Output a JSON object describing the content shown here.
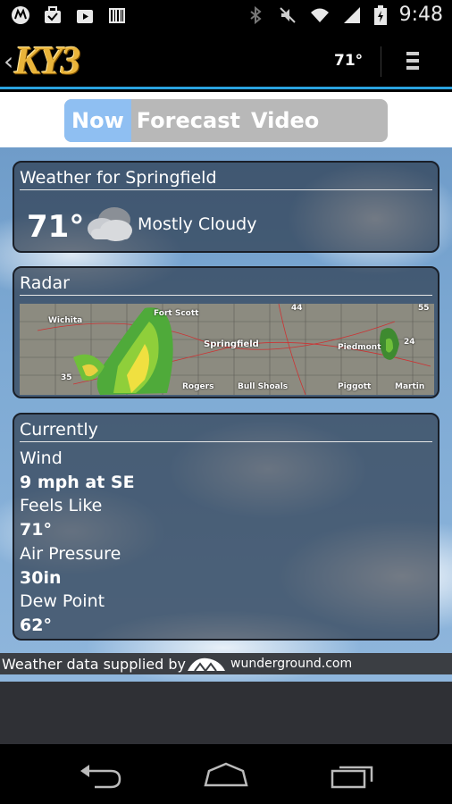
{
  "status_bar": {
    "time": "9:48",
    "left_icons": [
      "motorola-icon",
      "briefcase-icon",
      "play-store-icon",
      "barcode-icon"
    ],
    "right_icons": [
      "bluetooth-icon",
      "mute-icon",
      "wifi-icon",
      "signal-icon",
      "battery-icon"
    ]
  },
  "app_bar": {
    "logo_text": "KY3",
    "temperature": "71°",
    "menu_icon": "menu-icon"
  },
  "tabs": [
    {
      "label": "Now",
      "active": true
    },
    {
      "label": "Forecast",
      "active": false
    },
    {
      "label": "Video Forecast",
      "active": false
    }
  ],
  "weather_card": {
    "title": "Weather for Springfield",
    "temperature": "71°",
    "condition": "Mostly Cloudy",
    "icon": "cloud-icon"
  },
  "radar_card": {
    "title": "Radar",
    "map_labels": [
      "Wichita",
      "Fort Scott",
      "Springfield",
      "Piedmont",
      "Rogers",
      "Bull Shoals",
      "Piggott",
      "Martin",
      "35",
      "44",
      "24",
      "55"
    ]
  },
  "currently_card": {
    "title": "Currently",
    "rows": [
      {
        "label": "Wind",
        "value": "9 mph at SE"
      },
      {
        "label": "Feels Like",
        "value": "71°"
      },
      {
        "label": "Air Pressure",
        "value": "30in"
      },
      {
        "label": "Dew Point",
        "value": "62°"
      }
    ]
  },
  "attribution": {
    "text": "Weather data supplied by",
    "provider": "wunderground.com"
  },
  "nav_bar": {
    "buttons": [
      "back-icon",
      "home-icon",
      "recents-icon"
    ]
  },
  "colors": {
    "accent": "#2aa3e0",
    "active_tab": "#8fbff2",
    "logo": "#e9b43a"
  }
}
